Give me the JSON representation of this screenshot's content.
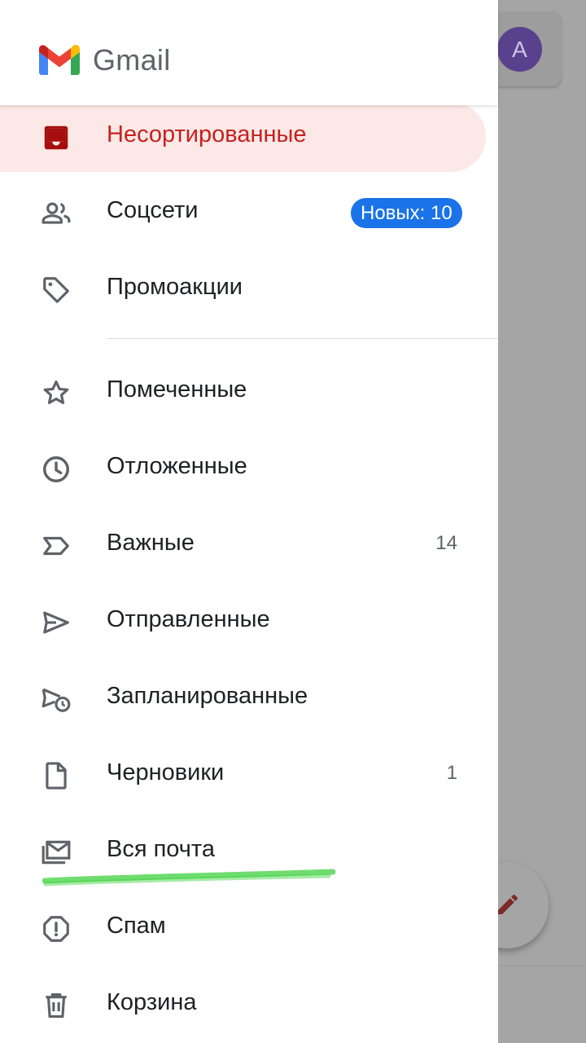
{
  "app": {
    "title": "Gmail"
  },
  "account": {
    "avatar_letter": "A"
  },
  "drawer": {
    "items": [
      {
        "label": "Несортированные",
        "icon": "inbox-icon",
        "active": true
      },
      {
        "label": "Соцсети",
        "icon": "people-icon",
        "badge": "Новых: 10"
      },
      {
        "label": "Промоакции",
        "icon": "tag-icon"
      },
      {
        "label": "Помеченные",
        "icon": "star-icon"
      },
      {
        "label": "Отложенные",
        "icon": "clock-icon"
      },
      {
        "label": "Важные",
        "icon": "important-icon",
        "count": "14"
      },
      {
        "label": "Отправленные",
        "icon": "send-icon"
      },
      {
        "label": "Запланированные",
        "icon": "scheduled-send-icon"
      },
      {
        "label": "Черновики",
        "icon": "draft-icon",
        "count": "1"
      },
      {
        "label": "Вся почта",
        "icon": "all-mail-icon"
      },
      {
        "label": "Спам",
        "icon": "spam-icon"
      },
      {
        "label": "Корзина",
        "icon": "trash-icon"
      }
    ]
  },
  "colors": {
    "active_bg": "#fce8e6",
    "active_text": "#c5221f",
    "badge_bg": "#1a73e8",
    "highlight": "#3fd03f"
  }
}
